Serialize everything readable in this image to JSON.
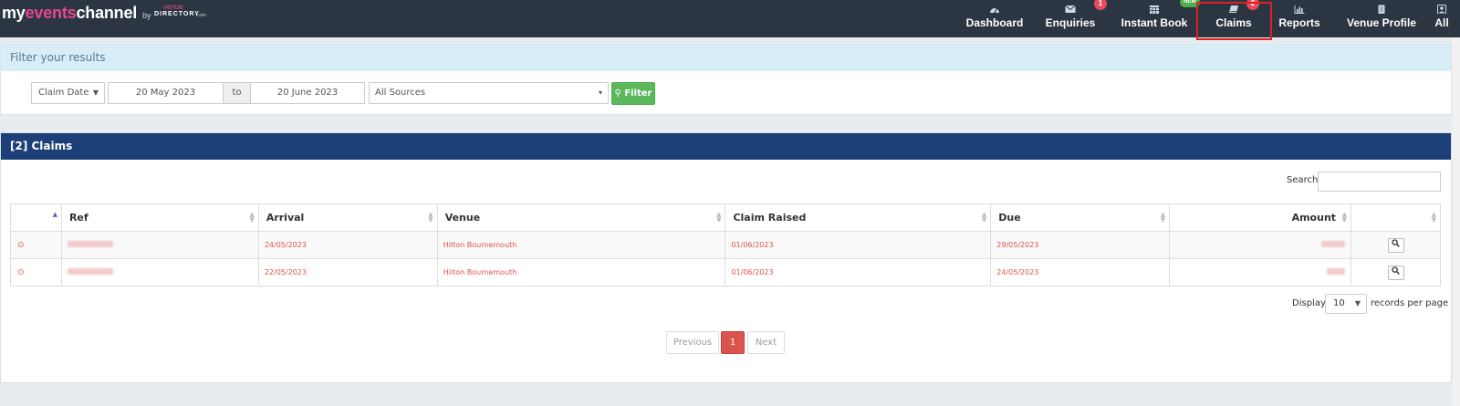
{
  "brand": {
    "my": "my",
    "events": "events",
    "channel": "channel",
    "by": "by",
    "venue": "venue",
    "directory": "DIRECTORY",
    "com": ".com"
  },
  "nav": [
    {
      "label": "Dashboard",
      "icon": "dashboard-icon"
    },
    {
      "label": "Enquiries",
      "icon": "envelope-icon",
      "badge": "1"
    },
    {
      "label": "Instant Book",
      "icon": "calendar-icon",
      "badge": "NEW"
    },
    {
      "label": "Claims",
      "icon": "book-icon",
      "badge": "2"
    },
    {
      "label": "Reports",
      "icon": "bar-chart-icon"
    },
    {
      "label": "Venue Profile",
      "icon": "document-icon"
    },
    {
      "label": "All",
      "icon": "user-icon"
    }
  ],
  "filter": {
    "title": "Filter your results",
    "date_type": "Claim Date",
    "date_from": "20 May 2023",
    "to_label": "to",
    "date_to": "20 June 2023",
    "source": "All Sources",
    "button_label": "Filter"
  },
  "claims": {
    "title": "[2] Claims",
    "search_label": "Search:",
    "columns": [
      "",
      "Ref",
      "Arrival",
      "Venue",
      "Claim Raised",
      "Due",
      "Amount",
      ""
    ],
    "rows": [
      {
        "arrival": "24/05/2023",
        "venue": "Hilton Bournemouth",
        "claim_raised": "01/06/2023",
        "due": "29/05/2023"
      },
      {
        "arrival": "22/05/2023",
        "venue": "Hilton Bournemouth",
        "claim_raised": "01/06/2023",
        "due": "24/05/2023"
      }
    ],
    "display_label": "Display",
    "display_value": "10",
    "display_suffix": "records per page",
    "pagination": {
      "previous": "Previous",
      "current": "1",
      "next": "Next"
    }
  },
  "colors": {
    "navbar": "#2b3642",
    "accent_pink": "#e8488c",
    "panel_header": "#1d3f78",
    "filter_header": "#d9edf7",
    "danger": "#d9534f",
    "success": "#5cb85c"
  }
}
